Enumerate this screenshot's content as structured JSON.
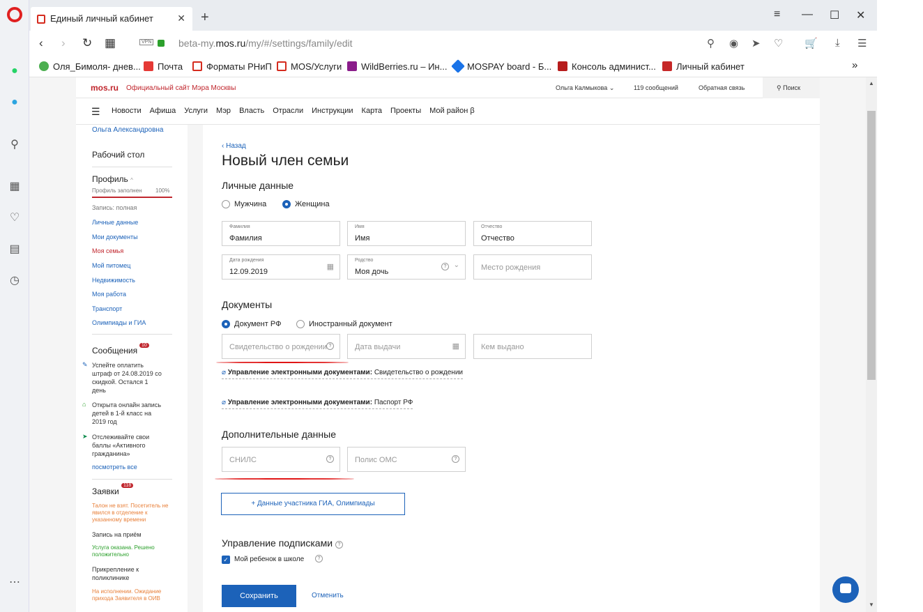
{
  "browser": {
    "tab_title": "Единый личный кабинет",
    "url_prefix": "beta-my.",
    "url_domain": "mos.ru",
    "url_path": "/my/#/settings/family/edit",
    "vpn": "VPN",
    "bookmarks": [
      "Оля_Бимоля- днев...",
      "Почта",
      "Форматы РНиП",
      "MOS/Услуги",
      "WildBerries.ru – Ин...",
      "MOSPAY board - Б...",
      "Консоль админист...",
      "Личный кабинет"
    ]
  },
  "header": {
    "logo": "mos.ru",
    "tagline": "Официальный сайт Мэра Москвы",
    "user": "Ольга Калмыкова",
    "messages": "119 сообщений",
    "feedback": "Обратная связь",
    "search": "Поиск"
  },
  "menu": [
    "Новости",
    "Афиша",
    "Услуги",
    "Мэр",
    "Власть",
    "Отрасли",
    "Инструкции",
    "Карта",
    "Проекты",
    "Мой район β"
  ],
  "sidebar": {
    "name": "Ольга Александровна",
    "desktop": "Рабочий стол",
    "profile": "Профиль",
    "profile_filled": "Профиль заполнен",
    "profile_pct": "100%",
    "record": "Запись: полная",
    "links": [
      "Личные данные",
      "Мои документы",
      "Моя семья",
      "Мой питомец",
      "Недвижимость",
      "Моя работа",
      "Транспорт",
      "Олимпиады и ГИА"
    ],
    "messages_title": "Сообщения",
    "messages_badge": "10",
    "msg1": "Успейте оплатить штраф от 24.08.2019 со скидкой. Остался 1 день",
    "msg2": "Открыта онлайн запись детей в 1-й класс на 2019 год",
    "msg3": "Отслеживайте свои баллы «Активного гражданина»",
    "see_all": "посмотреть все",
    "requests_title": "Заявки",
    "requests_badge": "118",
    "req1": "Талон не взят. Посетитель не явился в отделение к указанному времени",
    "req2": "Запись на приём",
    "req3": "Услуга оказана. Решено положительно",
    "req4": "Прикрепление к поликлинике",
    "req5": "На исполнении. Ожидание прихода Заявителя в ОИВ"
  },
  "form": {
    "back": "‹ Назад",
    "title": "Новый член семьи",
    "personal": "Личные данные",
    "male": "Мужчина",
    "female": "Женщина",
    "lastname_lbl": "Фамилия",
    "lastname_val": "Фамилия",
    "firstname_lbl": "Имя",
    "firstname_val": "Имя",
    "patr_lbl": "Отчество",
    "patr_val": "Отчество",
    "dob_lbl": "Дата рождения",
    "dob_val": "12.09.2019",
    "kin_lbl": "Родство",
    "kin_val": "Моя дочь",
    "birthplace_ph": "Место рождения",
    "docs": "Документы",
    "doc_rf": "Документ РФ",
    "doc_foreign": "Иностранный документ",
    "cert_ph": "Свидетельство о рождении",
    "issue_date_ph": "Дата выдачи",
    "issued_by_ph": "Кем выдано",
    "edoc_label": "Управление электронными документами:",
    "edoc1": "Свидетельство о рождении",
    "edoc2": "Паспорт РФ",
    "extra": "Дополнительные данные",
    "snils_ph": "СНИЛС",
    "oms_ph": "Полис ОМС",
    "gia_btn": "+ Данные участника ГИА, Олимпиады",
    "subs": "Управление подписками",
    "school": "Мой ребенок в школе",
    "save": "Сохранить",
    "cancel": "Отменить"
  }
}
